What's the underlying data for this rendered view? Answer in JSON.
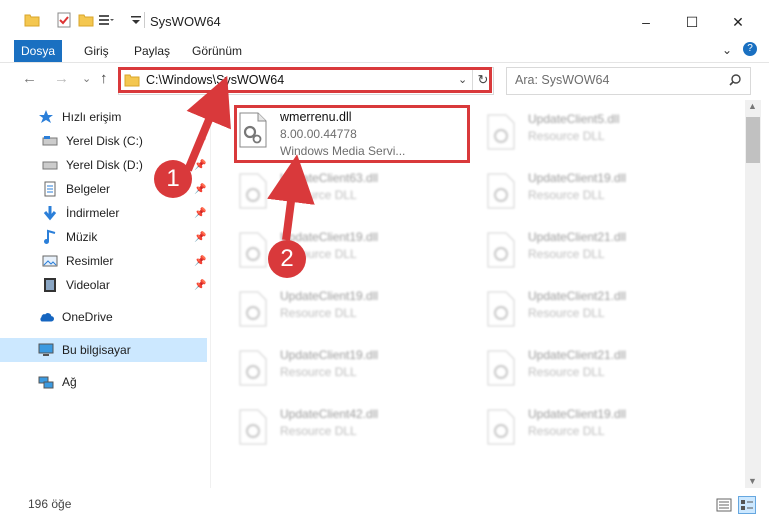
{
  "window": {
    "title": "SysWOW64",
    "minimize": "–",
    "maximize": "☐",
    "close": "✕"
  },
  "ribbon": {
    "tabs": [
      "Dosya",
      "Giriş",
      "Paylaş",
      "Görünüm"
    ],
    "collapse": "⌄",
    "help": "?"
  },
  "nav": {
    "back": "←",
    "forward": "→",
    "recent": "⌄",
    "up": "↑",
    "address": "C:\\Windows\\SysWOW64",
    "refresh": "↻",
    "search_placeholder": "Ara: SysWOW64"
  },
  "sidebar": {
    "items": [
      {
        "label": "Hızlı erişim",
        "icon": "star-icon"
      },
      {
        "label": "Yerel Disk (C:)",
        "icon": "drive-icon"
      },
      {
        "label": "Yerel Disk (D:)",
        "icon": "drive-icon"
      },
      {
        "label": "Belgeler",
        "icon": "documents-icon"
      },
      {
        "label": "İndirmeler",
        "icon": "download-icon"
      },
      {
        "label": "Müzik",
        "icon": "music-icon"
      },
      {
        "label": "Resimler",
        "icon": "pictures-icon"
      },
      {
        "label": "Videolar",
        "icon": "videos-icon"
      },
      {
        "label": "OneDrive",
        "icon": "cloud-icon"
      },
      {
        "label": "Bu bilgisayar",
        "icon": "computer-icon"
      },
      {
        "label": "Ağ",
        "icon": "network-icon"
      }
    ]
  },
  "files": {
    "selected": {
      "name": "wmerrenu.dll",
      "version": "8.00.00.44778",
      "description": "Windows Media Servi..."
    },
    "col1": [
      {
        "name": "UpdateClient63.dll",
        "type": "Resource DLL"
      },
      {
        "name": "UpdateClient19.dll",
        "type": "Resource DLL"
      },
      {
        "name": "UpdateClient19.dll",
        "type": "Resource DLL"
      },
      {
        "name": "UpdateClient19.dll",
        "type": "Resource DLL"
      },
      {
        "name": "UpdateClient42.dll",
        "type": "Resource DLL"
      }
    ],
    "col2": [
      {
        "name": "UpdateClient5.dll",
        "type": "Resource DLL"
      },
      {
        "name": "UpdateClient19.dll",
        "type": "Resource DLL"
      },
      {
        "name": "UpdateClient21.dll",
        "type": "Resource DLL"
      },
      {
        "name": "UpdateClient21.dll",
        "type": "Resource DLL"
      },
      {
        "name": "UpdateClient21.dll",
        "type": "Resource DLL"
      },
      {
        "name": "UpdateClient19.dll",
        "type": "Resource DLL"
      }
    ]
  },
  "status": {
    "count": "196 öğe"
  },
  "callouts": [
    "1",
    "2"
  ],
  "colors": {
    "accent": "#1a70c1",
    "highlight": "#d9393b",
    "selection": "#cce8ff"
  }
}
